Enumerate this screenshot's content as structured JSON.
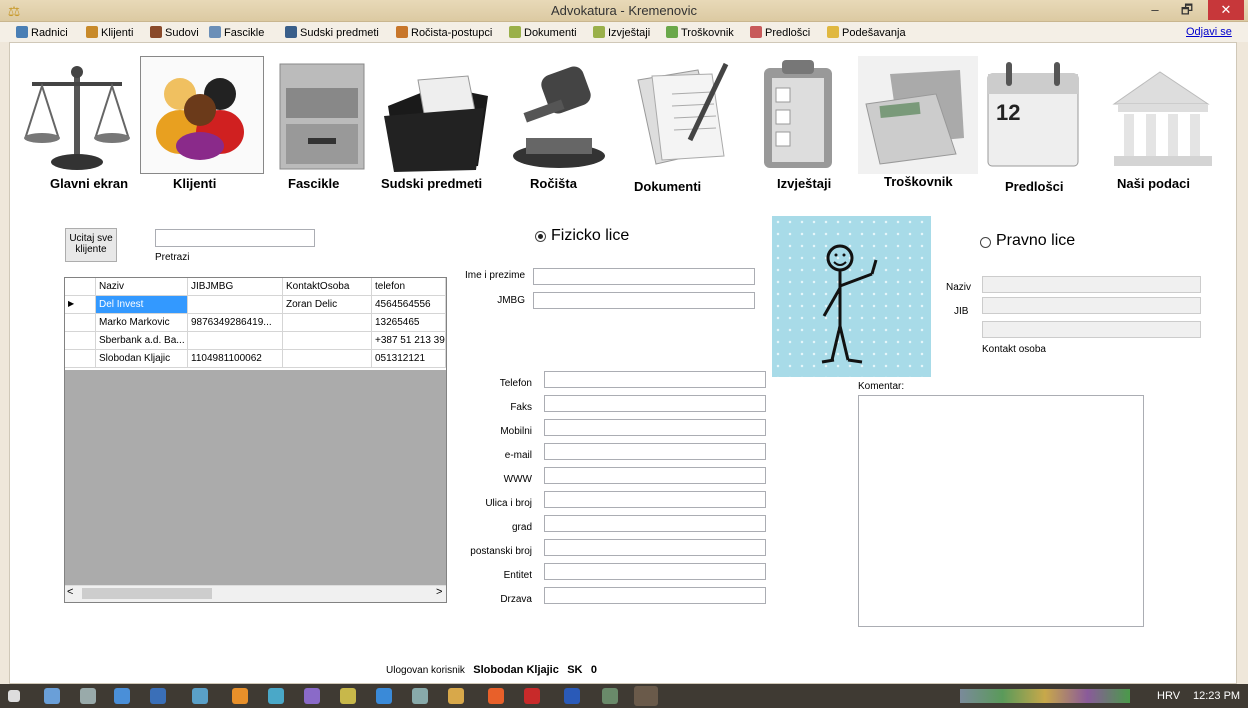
{
  "window": {
    "title": "Advokatura - Kremenovic",
    "minimize": "–",
    "maximize": "🗗",
    "close": "✕"
  },
  "menu": {
    "items": [
      {
        "label": "Radnici",
        "color": "#4a7fb5"
      },
      {
        "label": "Klijenti",
        "color": "#c88a2a"
      },
      {
        "label": "Sudovi",
        "color": "#8a4a2a"
      },
      {
        "label": "Fascikle",
        "color": "#6b8fb8"
      },
      {
        "label": "Sudski predmeti",
        "color": "#3a5f8a"
      },
      {
        "label": "Ročista-postupci",
        "color": "#c8762a"
      },
      {
        "label": "Dokumenti",
        "color": "#9ab04a"
      },
      {
        "label": "Izvještaji",
        "color": "#9ab04a"
      },
      {
        "label": "Troškovnik",
        "color": "#6aa84a"
      },
      {
        "label": "Predlošci",
        "color": "#c85a5a"
      },
      {
        "label": "Podešavanja",
        "color": "#e0b840"
      }
    ],
    "logout": "Odjavi se"
  },
  "nav": [
    {
      "label": "Glavni ekran",
      "icon": "scales-icon"
    },
    {
      "label": "Klijenti",
      "icon": "people-icon"
    },
    {
      "label": "Fascikle",
      "icon": "file-cabinet-icon"
    },
    {
      "label": "Sudski predmeti",
      "icon": "folder-icon"
    },
    {
      "label": "Ročišta",
      "icon": "gavel-icon"
    },
    {
      "label": "Dokumenti",
      "icon": "documents-icon"
    },
    {
      "label": "Izvještaji",
      "icon": "clipboard-icon"
    },
    {
      "label": "Troškovnik",
      "icon": "calculator-icon"
    },
    {
      "label": "Predlošci",
      "icon": "calendar-icon"
    },
    {
      "label": "Naši podaci",
      "icon": "building-icon"
    }
  ],
  "calendar_day": "12",
  "left": {
    "load_button": "Ucitaj sve klijente",
    "search_label": "Pretrazi",
    "search_value": ""
  },
  "grid": {
    "columns": [
      "Naziv",
      "JIBJMBG",
      "KontaktOsoba",
      "telefon"
    ],
    "rows": [
      [
        "Del Invest",
        "",
        "Zoran Delic",
        "4564564556"
      ],
      [
        "Marko Markovic",
        "9876349286419...",
        "",
        "13265465"
      ],
      [
        "Sberbank a.d. Ba...",
        "",
        "",
        "+387 51 213 39"
      ],
      [
        "Slobodan Kljajic",
        "1104981100062",
        "",
        "051312121"
      ]
    ],
    "scroll_left": "<",
    "scroll_right": ">"
  },
  "fizicko": {
    "radio_label": "Fizicko lice",
    "fields": [
      "Ime i prezime",
      "JMBG"
    ],
    "contact_fields": [
      "Telefon",
      "Faks",
      "Mobilni",
      "e-mail",
      "WWW",
      "Ulica i broj",
      "grad",
      "postanski broj",
      "Entitet",
      "Drzava"
    ]
  },
  "pravno": {
    "radio_label": "Pravno lice",
    "naziv": "Naziv",
    "jib": "JIB",
    "kontakt": "Kontakt osoba"
  },
  "komentar": "Komentar:",
  "status": {
    "label": "Ulogovan korisnik",
    "user": "Slobodan Kljajic",
    "code": "SK",
    "count": "0"
  },
  "tray": {
    "lang": "HRV",
    "time": "12:23 PM"
  },
  "colors": {
    "selected_row": "#3399ff",
    "picture_bg": "#a8dbe8",
    "grid_empty": "#ababab"
  }
}
